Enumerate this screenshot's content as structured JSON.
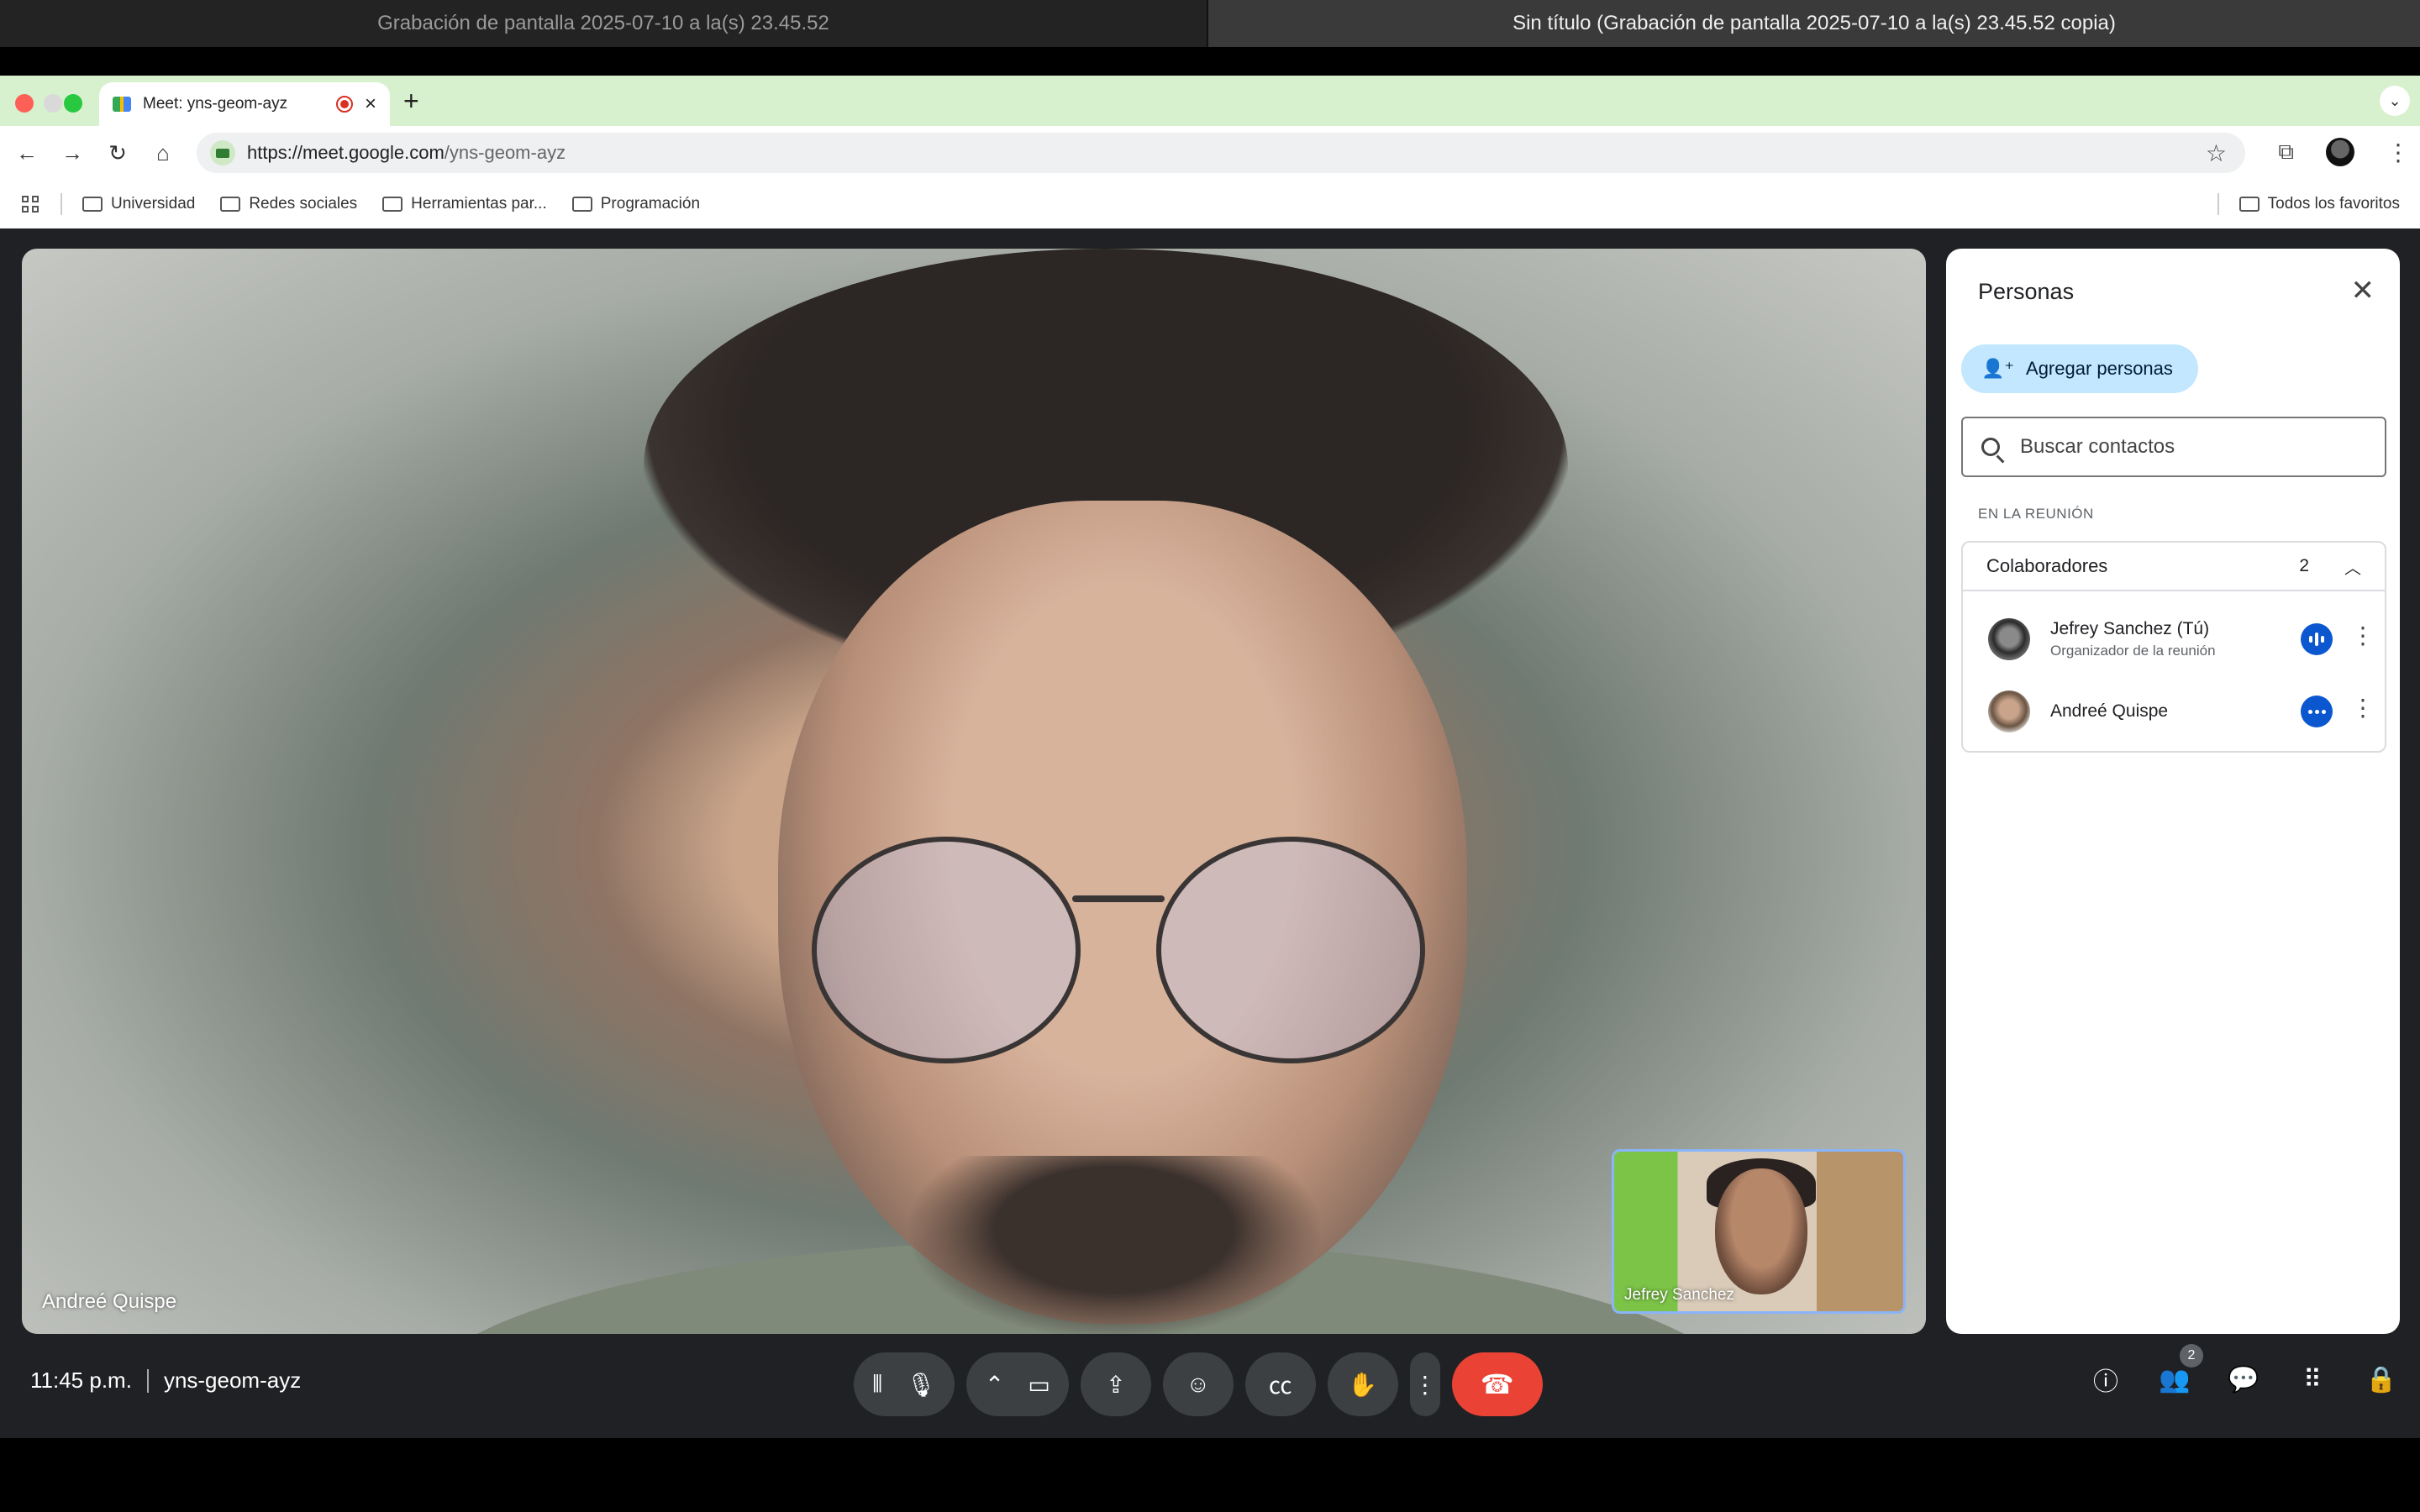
{
  "recording_tabs": {
    "left": "Grabación de pantalla 2025-07-10 a la(s) 23.45.52",
    "right": "Sin título (Grabación de pantalla 2025-07-10 a la(s) 23.45.52 copia)"
  },
  "browser": {
    "tab_title": "Meet: yns-geom-ayz",
    "url_host": "https://meet.google.com",
    "url_path": "/yns-geom-ayz",
    "bookmarks": [
      "Universidad",
      "Redes sociales",
      "Herramientas par...",
      "Programación"
    ],
    "bookmarks_right": "Todos los favoritos"
  },
  "meeting": {
    "main_speaker": "Andreé Quispe",
    "self_view_name": "Jefrey Sanchez",
    "time": "11:45 p.m.",
    "code": "yns-geom-ayz",
    "people_badge": "2"
  },
  "panel": {
    "title": "Personas",
    "add_label": "Agregar personas",
    "search_placeholder": "Buscar contactos",
    "section_label": "EN LA REUNIÓN",
    "group_name": "Colaboradores",
    "group_count": "2",
    "people": [
      {
        "name": "Jefrey Sanchez (Tú)",
        "subtitle": "Organizador de la reunión"
      },
      {
        "name": "Andreé Quispe",
        "subtitle": ""
      }
    ]
  },
  "colors": {
    "accent": "#0b57d0",
    "end_call": "#ea4335",
    "add_people_bg": "#c2e7ff",
    "tabbar": "#d7f0cd"
  }
}
